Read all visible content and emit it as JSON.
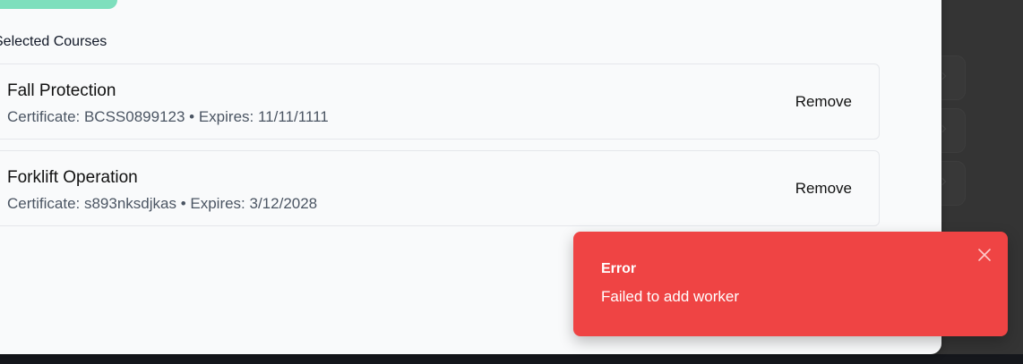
{
  "modal": {
    "section_title": "Selected Courses",
    "courses": [
      {
        "name": "Fall Protection",
        "meta": "Certificate: BCSS0899123 • Expires: 11/11/1111",
        "remove_label": "Remove"
      },
      {
        "name": "Forklift Operation",
        "meta": "Certificate: s893nksdjkas • Expires: 3/12/2028",
        "remove_label": "Remove"
      }
    ]
  },
  "toast": {
    "title": "Error",
    "message": "Failed to add worker",
    "close_icon": "close-icon",
    "color": "#ef4444"
  },
  "colors": {
    "accent_button": "#7edfbd",
    "backdrop": "#343434",
    "modal_bg": "#f9fafb"
  }
}
